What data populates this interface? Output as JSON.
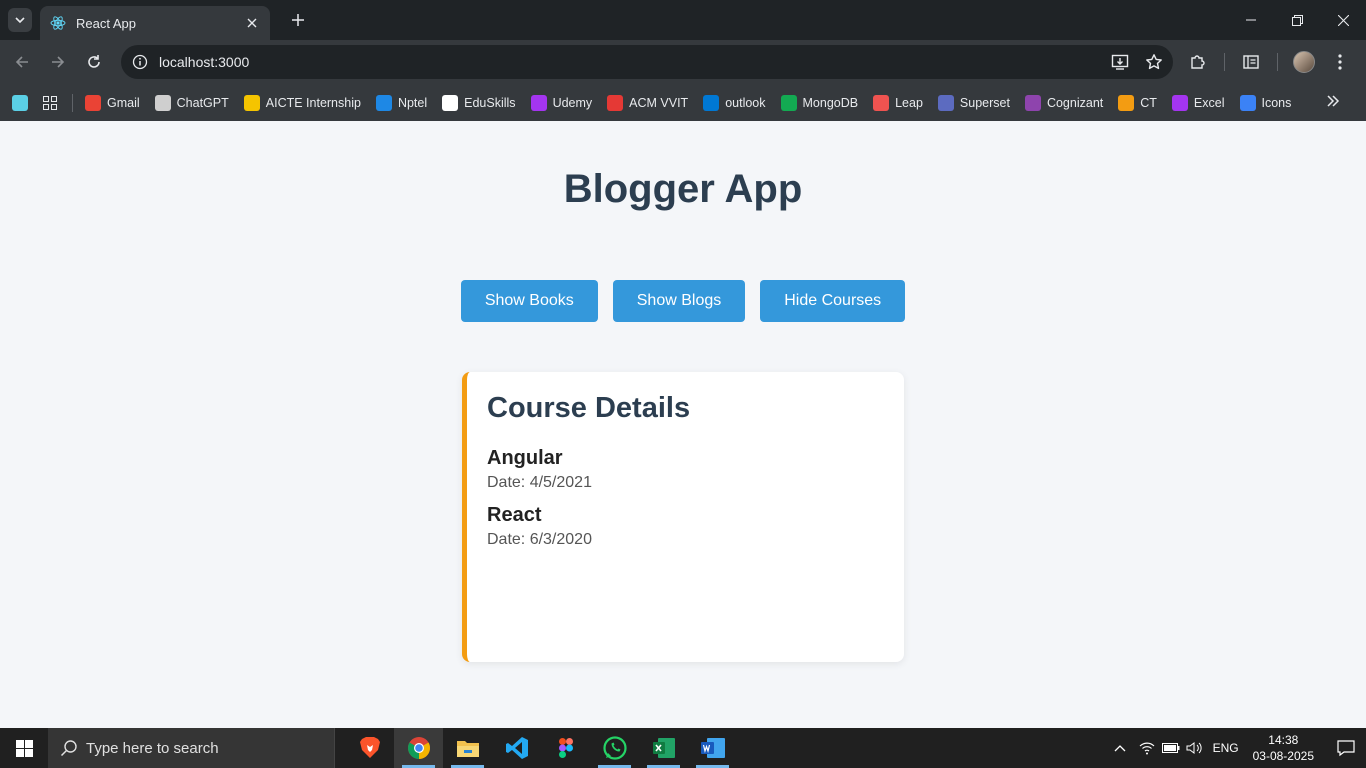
{
  "browser": {
    "tab_title": "React App",
    "url": "localhost:3000"
  },
  "bookmarks": [
    {
      "label": "Gmail",
      "icon": "gmail-icon",
      "color": "#ea4335"
    },
    {
      "label": "ChatGPT",
      "icon": "chatgpt-icon",
      "color": "#cfcfcf"
    },
    {
      "label": "AICTE Internship",
      "icon": "aicte-icon",
      "color": "#f5c400"
    },
    {
      "label": "Nptel",
      "icon": "nptel-icon",
      "color": "#1e88e5"
    },
    {
      "label": "EduSkills",
      "icon": "eduskills-icon",
      "color": "#ffffff"
    },
    {
      "label": "Udemy",
      "icon": "udemy-icon",
      "color": "#a435f0"
    },
    {
      "label": "ACM VVIT",
      "icon": "acm-icon",
      "color": "#e53935"
    },
    {
      "label": "outlook",
      "icon": "outlook-icon",
      "color": "#0078d4"
    },
    {
      "label": "MongoDB",
      "icon": "mongodb-icon",
      "color": "#13aa52"
    },
    {
      "label": "Leap",
      "icon": "leap-icon",
      "color": "#ef5350"
    },
    {
      "label": "Superset",
      "icon": "superset-icon",
      "color": "#5c6bc0"
    },
    {
      "label": "Cognizant",
      "icon": "cognizant-icon",
      "color": "#8e44ad"
    },
    {
      "label": "CT",
      "icon": "ct-icon",
      "color": "#f39c12"
    },
    {
      "label": "Excel",
      "icon": "excel-icon",
      "color": "#a435f0"
    },
    {
      "label": "Icons",
      "icon": "icons-icon",
      "color": "#3b82f6"
    }
  ],
  "app": {
    "title": "Blogger App",
    "buttons": {
      "books": "Show Books",
      "blogs": "Show Blogs",
      "courses": "Hide Courses"
    },
    "course_card": {
      "heading": "Course Details",
      "courses": [
        {
          "name": "Angular",
          "date": "Date: 4/5/2021"
        },
        {
          "name": "React",
          "date": "Date: 6/3/2020"
        }
      ]
    }
  },
  "taskbar": {
    "search_placeholder": "Type here to search",
    "language": "ENG",
    "time": "14:38",
    "date": "03-08-2025"
  }
}
